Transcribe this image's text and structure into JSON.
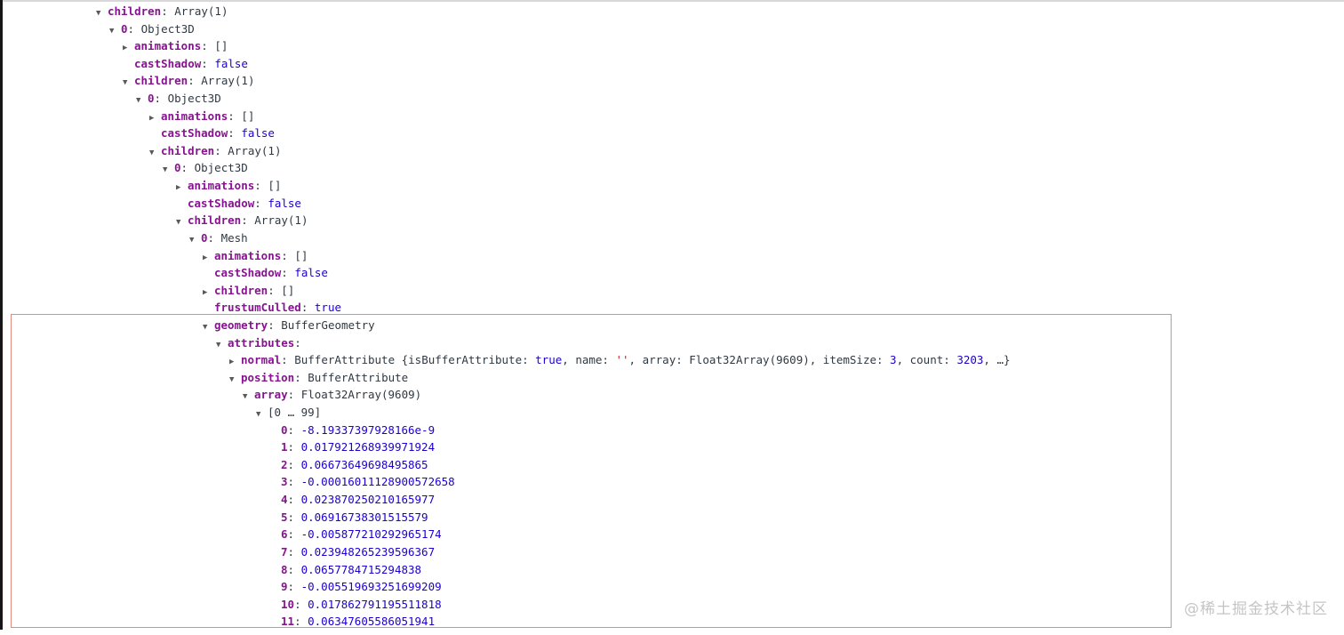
{
  "colors": {
    "key": "#881391",
    "value": "#1c00cf",
    "string": "#c41a16",
    "plain": "#303942",
    "arrow": "#595959",
    "box": "#e8897f",
    "chrome-border": "#d8d8d8",
    "edge": "#161616",
    "watermark": "#c5c5c5"
  },
  "watermark": {
    "text": "@稀土掘金技术社区"
  },
  "console": {
    "rows": [
      {
        "indent": 1,
        "arrow": "down",
        "tokens": [
          {
            "t": "children",
            "c": "key"
          },
          {
            "t": ": ",
            "c": "plain"
          },
          {
            "t": "Array(1)",
            "c": "plain"
          }
        ]
      },
      {
        "indent": 2,
        "arrow": "down",
        "tokens": [
          {
            "t": "0",
            "c": "key"
          },
          {
            "t": ": ",
            "c": "plain"
          },
          {
            "t": "Object3D",
            "c": "plain"
          }
        ]
      },
      {
        "indent": 3,
        "arrow": "right",
        "tokens": [
          {
            "t": "animations",
            "c": "key"
          },
          {
            "t": ": ",
            "c": "plain"
          },
          {
            "t": "[]",
            "c": "plain"
          }
        ]
      },
      {
        "indent": 3,
        "arrow": "none",
        "tokens": [
          {
            "t": "castShadow",
            "c": "key"
          },
          {
            "t": ": ",
            "c": "plain"
          },
          {
            "t": "false",
            "c": "value"
          }
        ]
      },
      {
        "indent": 3,
        "arrow": "down",
        "tokens": [
          {
            "t": "children",
            "c": "key"
          },
          {
            "t": ": ",
            "c": "plain"
          },
          {
            "t": "Array(1)",
            "c": "plain"
          }
        ]
      },
      {
        "indent": 4,
        "arrow": "down",
        "tokens": [
          {
            "t": "0",
            "c": "key"
          },
          {
            "t": ": ",
            "c": "plain"
          },
          {
            "t": "Object3D",
            "c": "plain"
          }
        ]
      },
      {
        "indent": 5,
        "arrow": "right",
        "tokens": [
          {
            "t": "animations",
            "c": "key"
          },
          {
            "t": ": ",
            "c": "plain"
          },
          {
            "t": "[]",
            "c": "plain"
          }
        ]
      },
      {
        "indent": 5,
        "arrow": "none",
        "tokens": [
          {
            "t": "castShadow",
            "c": "key"
          },
          {
            "t": ": ",
            "c": "plain"
          },
          {
            "t": "false",
            "c": "value"
          }
        ]
      },
      {
        "indent": 5,
        "arrow": "down",
        "tokens": [
          {
            "t": "children",
            "c": "key"
          },
          {
            "t": ": ",
            "c": "plain"
          },
          {
            "t": "Array(1)",
            "c": "plain"
          }
        ]
      },
      {
        "indent": 6,
        "arrow": "down",
        "tokens": [
          {
            "t": "0",
            "c": "key"
          },
          {
            "t": ": ",
            "c": "plain"
          },
          {
            "t": "Object3D",
            "c": "plain"
          }
        ]
      },
      {
        "indent": 7,
        "arrow": "right",
        "tokens": [
          {
            "t": "animations",
            "c": "key"
          },
          {
            "t": ": ",
            "c": "plain"
          },
          {
            "t": "[]",
            "c": "plain"
          }
        ]
      },
      {
        "indent": 7,
        "arrow": "none",
        "tokens": [
          {
            "t": "castShadow",
            "c": "key"
          },
          {
            "t": ": ",
            "c": "plain"
          },
          {
            "t": "false",
            "c": "value"
          }
        ]
      },
      {
        "indent": 7,
        "arrow": "down",
        "tokens": [
          {
            "t": "children",
            "c": "key"
          },
          {
            "t": ": ",
            "c": "plain"
          },
          {
            "t": "Array(1)",
            "c": "plain"
          }
        ]
      },
      {
        "indent": 8,
        "arrow": "down",
        "tokens": [
          {
            "t": "0",
            "c": "key"
          },
          {
            "t": ": ",
            "c": "plain"
          },
          {
            "t": "Mesh",
            "c": "plain"
          }
        ]
      },
      {
        "indent": 9,
        "arrow": "right",
        "tokens": [
          {
            "t": "animations",
            "c": "key"
          },
          {
            "t": ": ",
            "c": "plain"
          },
          {
            "t": "[]",
            "c": "plain"
          }
        ]
      },
      {
        "indent": 9,
        "arrow": "none",
        "tokens": [
          {
            "t": "castShadow",
            "c": "key"
          },
          {
            "t": ": ",
            "c": "plain"
          },
          {
            "t": "false",
            "c": "value"
          }
        ]
      },
      {
        "indent": 9,
        "arrow": "right",
        "tokens": [
          {
            "t": "children",
            "c": "key"
          },
          {
            "t": ": ",
            "c": "plain"
          },
          {
            "t": "[]",
            "c": "plain"
          }
        ]
      },
      {
        "indent": 9,
        "arrow": "none",
        "tokens": [
          {
            "t": "frustumCulled",
            "c": "key"
          },
          {
            "t": ": ",
            "c": "plain"
          },
          {
            "t": "true",
            "c": "value"
          }
        ]
      },
      {
        "indent": 9,
        "arrow": "down",
        "tokens": [
          {
            "t": "geometry",
            "c": "key"
          },
          {
            "t": ": ",
            "c": "plain"
          },
          {
            "t": "BufferGeometry",
            "c": "plain"
          }
        ]
      },
      {
        "indent": 10,
        "arrow": "down",
        "tokens": [
          {
            "t": "attributes",
            "c": "key"
          },
          {
            "t": ":",
            "c": "plain"
          }
        ]
      },
      {
        "indent": 11,
        "arrow": "right",
        "tokens": [
          {
            "t": "normal",
            "c": "key"
          },
          {
            "t": ": ",
            "c": "plain"
          },
          {
            "t": "BufferAttribute {isBufferAttribute: ",
            "c": "plain"
          },
          {
            "t": "true",
            "c": "value"
          },
          {
            "t": ", name: ",
            "c": "plain"
          },
          {
            "t": "''",
            "c": "string"
          },
          {
            "t": ", array: Float32Array(9609), itemSize: ",
            "c": "plain"
          },
          {
            "t": "3",
            "c": "value"
          },
          {
            "t": ", count: ",
            "c": "plain"
          },
          {
            "t": "3203",
            "c": "value"
          },
          {
            "t": ", …}",
            "c": "plain"
          }
        ]
      },
      {
        "indent": 11,
        "arrow": "down",
        "tokens": [
          {
            "t": "position",
            "c": "key"
          },
          {
            "t": ": ",
            "c": "plain"
          },
          {
            "t": "BufferAttribute",
            "c": "plain"
          }
        ]
      },
      {
        "indent": 12,
        "arrow": "down",
        "tokens": [
          {
            "t": "array",
            "c": "key"
          },
          {
            "t": ": ",
            "c": "plain"
          },
          {
            "t": "Float32Array(9609)",
            "c": "plain"
          }
        ]
      },
      {
        "indent": 13,
        "arrow": "down",
        "tokens": [
          {
            "t": "[0 … 99]",
            "c": "plain"
          }
        ]
      },
      {
        "indent": 14,
        "arrow": "none",
        "tokens": [
          {
            "t": "0",
            "c": "key"
          },
          {
            "t": ": ",
            "c": "plain"
          },
          {
            "t": "-8.19337397928166e-9",
            "c": "value"
          }
        ]
      },
      {
        "indent": 14,
        "arrow": "none",
        "tokens": [
          {
            "t": "1",
            "c": "key"
          },
          {
            "t": ": ",
            "c": "plain"
          },
          {
            "t": "0.017921268939971924",
            "c": "value"
          }
        ]
      },
      {
        "indent": 14,
        "arrow": "none",
        "tokens": [
          {
            "t": "2",
            "c": "key"
          },
          {
            "t": ": ",
            "c": "plain"
          },
          {
            "t": "0.06673649698495865",
            "c": "value"
          }
        ]
      },
      {
        "indent": 14,
        "arrow": "none",
        "tokens": [
          {
            "t": "3",
            "c": "key"
          },
          {
            "t": ": ",
            "c": "plain"
          },
          {
            "t": "-0.00016011128900572658",
            "c": "value"
          }
        ]
      },
      {
        "indent": 14,
        "arrow": "none",
        "tokens": [
          {
            "t": "4",
            "c": "key"
          },
          {
            "t": ": ",
            "c": "plain"
          },
          {
            "t": "0.023870250210165977",
            "c": "value"
          }
        ]
      },
      {
        "indent": 14,
        "arrow": "none",
        "tokens": [
          {
            "t": "5",
            "c": "key"
          },
          {
            "t": ": ",
            "c": "plain"
          },
          {
            "t": "0.06916738301515579",
            "c": "value"
          }
        ]
      },
      {
        "indent": 14,
        "arrow": "none",
        "tokens": [
          {
            "t": "6",
            "c": "key"
          },
          {
            "t": ": ",
            "c": "plain"
          },
          {
            "t": "-0.005877210292965174",
            "c": "value"
          }
        ]
      },
      {
        "indent": 14,
        "arrow": "none",
        "tokens": [
          {
            "t": "7",
            "c": "key"
          },
          {
            "t": ": ",
            "c": "plain"
          },
          {
            "t": "0.023948265239596367",
            "c": "value"
          }
        ]
      },
      {
        "indent": 14,
        "arrow": "none",
        "tokens": [
          {
            "t": "8",
            "c": "key"
          },
          {
            "t": ": ",
            "c": "plain"
          },
          {
            "t": "0.0657784715294838",
            "c": "value"
          }
        ]
      },
      {
        "indent": 14,
        "arrow": "none",
        "tokens": [
          {
            "t": "9",
            "c": "key"
          },
          {
            "t": ": ",
            "c": "plain"
          },
          {
            "t": "-0.005519693251699209",
            "c": "value"
          }
        ]
      },
      {
        "indent": 14,
        "arrow": "none",
        "tokens": [
          {
            "t": "10",
            "c": "key"
          },
          {
            "t": ": ",
            "c": "plain"
          },
          {
            "t": "0.017862791195511818",
            "c": "value"
          }
        ]
      },
      {
        "indent": 14,
        "arrow": "none",
        "tokens": [
          {
            "t": "11",
            "c": "key"
          },
          {
            "t": ": ",
            "c": "plain"
          },
          {
            "t": "0.06347605586051941",
            "c": "value"
          }
        ]
      }
    ]
  }
}
